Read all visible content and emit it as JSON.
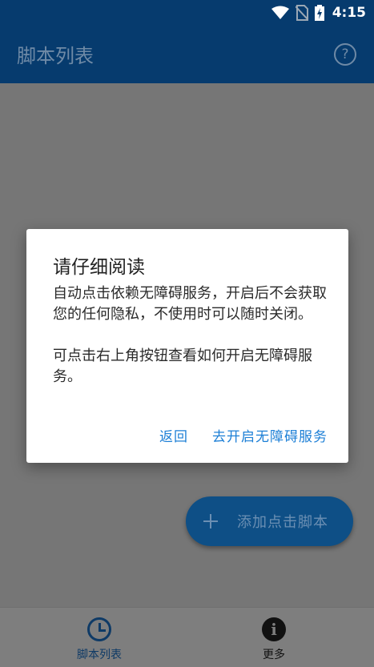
{
  "status_bar": {
    "time": "4:15"
  },
  "app_bar": {
    "title": "脚本列表",
    "help_icon": "?"
  },
  "fab": {
    "label": "添加点击脚本"
  },
  "bottom_nav": {
    "items": [
      {
        "label": "脚本列表",
        "icon": "clock-icon",
        "active": true
      },
      {
        "label": "更多",
        "icon": "info-icon",
        "active": false
      }
    ]
  },
  "dialog": {
    "title": "请仔细阅读",
    "paragraph1": "自动点击依赖无障碍服务，开启后不会获取您的任何隐私，不使用时可以随时关闭。",
    "paragraph2": "可点击右上角按钮查看如何开启无障碍服务。",
    "negative_label": "返回",
    "positive_label": "去开启无障碍服务",
    "accent_color": "#1c7fd6"
  },
  "colors": {
    "primary": "#063b6e",
    "scrim_gray": "#767676"
  }
}
